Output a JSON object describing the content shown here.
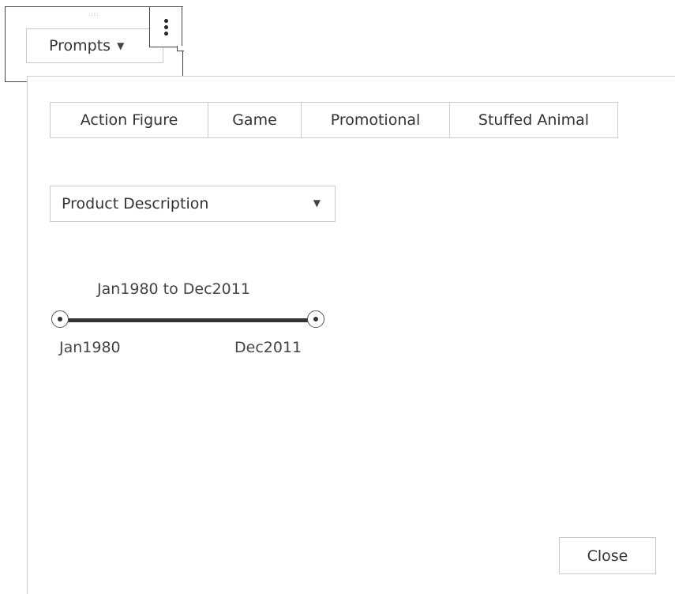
{
  "widget": {
    "grip": "::::",
    "prompt_button_label": "Prompts",
    "caret_glyph": "▼"
  },
  "panel": {
    "tabs": [
      {
        "label": "Action Figure"
      },
      {
        "label": "Game"
      },
      {
        "label": "Promotional"
      },
      {
        "label": "Stuffed Animal"
      }
    ],
    "dropdown": {
      "selected": "Product Description",
      "caret_glyph": "▼"
    },
    "date_range": {
      "summary": "Jan1980 to Dec2011",
      "min_label": "Jan1980",
      "max_label": "Dec2011",
      "selected_start": "Jan1980",
      "selected_end": "Dec2011"
    },
    "close_label": "Close"
  },
  "icons": {
    "kebab": "more-vertical-icon",
    "grip": "drag-handle-icon",
    "caret": "chevron-down-icon"
  },
  "colors": {
    "border_dark": "#444444",
    "border_light": "#cccccc",
    "text": "#333333",
    "track": "#333333"
  }
}
